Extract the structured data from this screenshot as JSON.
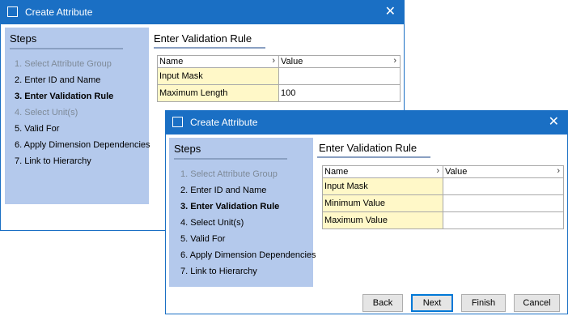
{
  "back_window": {
    "title": "Create Attribute",
    "close_glyph": "✕",
    "steps_heading": "Steps",
    "steps": [
      {
        "label": "1. Select Attribute Group",
        "state": "done"
      },
      {
        "label": "2. Enter ID and Name",
        "state": "normal"
      },
      {
        "label": "3. Enter Validation Rule",
        "state": "current"
      },
      {
        "label": "4. Select Unit(s)",
        "state": "done"
      },
      {
        "label": "5. Valid For",
        "state": "normal"
      },
      {
        "label": "6. Apply Dimension Dependencies",
        "state": "normal"
      },
      {
        "label": "7. Link to Hierarchy",
        "state": "normal"
      }
    ],
    "section_title": "Enter Validation Rule",
    "grid": {
      "columns": [
        "Name",
        "Value"
      ],
      "sort_glyph": "›",
      "rows": [
        {
          "name": "Input Mask",
          "value": ""
        },
        {
          "name": "Maximum Length",
          "value": "100"
        }
      ]
    }
  },
  "front_window": {
    "title": "Create Attribute",
    "close_glyph": "✕",
    "steps_heading": "Steps",
    "steps": [
      {
        "label": "1. Select Attribute Group",
        "state": "done"
      },
      {
        "label": "2. Enter ID and Name",
        "state": "normal"
      },
      {
        "label": "3. Enter Validation Rule",
        "state": "current"
      },
      {
        "label": "4. Select Unit(s)",
        "state": "normal"
      },
      {
        "label": "5. Valid For",
        "state": "normal"
      },
      {
        "label": "6. Apply Dimension Dependencies",
        "state": "normal"
      },
      {
        "label": "7. Link to Hierarchy",
        "state": "normal"
      }
    ],
    "section_title": "Enter Validation Rule",
    "grid": {
      "columns": [
        "Name",
        "Value"
      ],
      "sort_glyph": "›",
      "rows": [
        {
          "name": "Input Mask",
          "value": ""
        },
        {
          "name": "Minimum Value",
          "value": ""
        },
        {
          "name": "Maximum Value",
          "value": ""
        }
      ]
    },
    "buttons": {
      "back": "Back",
      "next": "Next",
      "finish": "Finish",
      "cancel": "Cancel"
    }
  },
  "colors": {
    "titlebar": "#1a6fc4",
    "steps_panel": "#b4c9ec",
    "property_cell": "#fff8c8"
  }
}
